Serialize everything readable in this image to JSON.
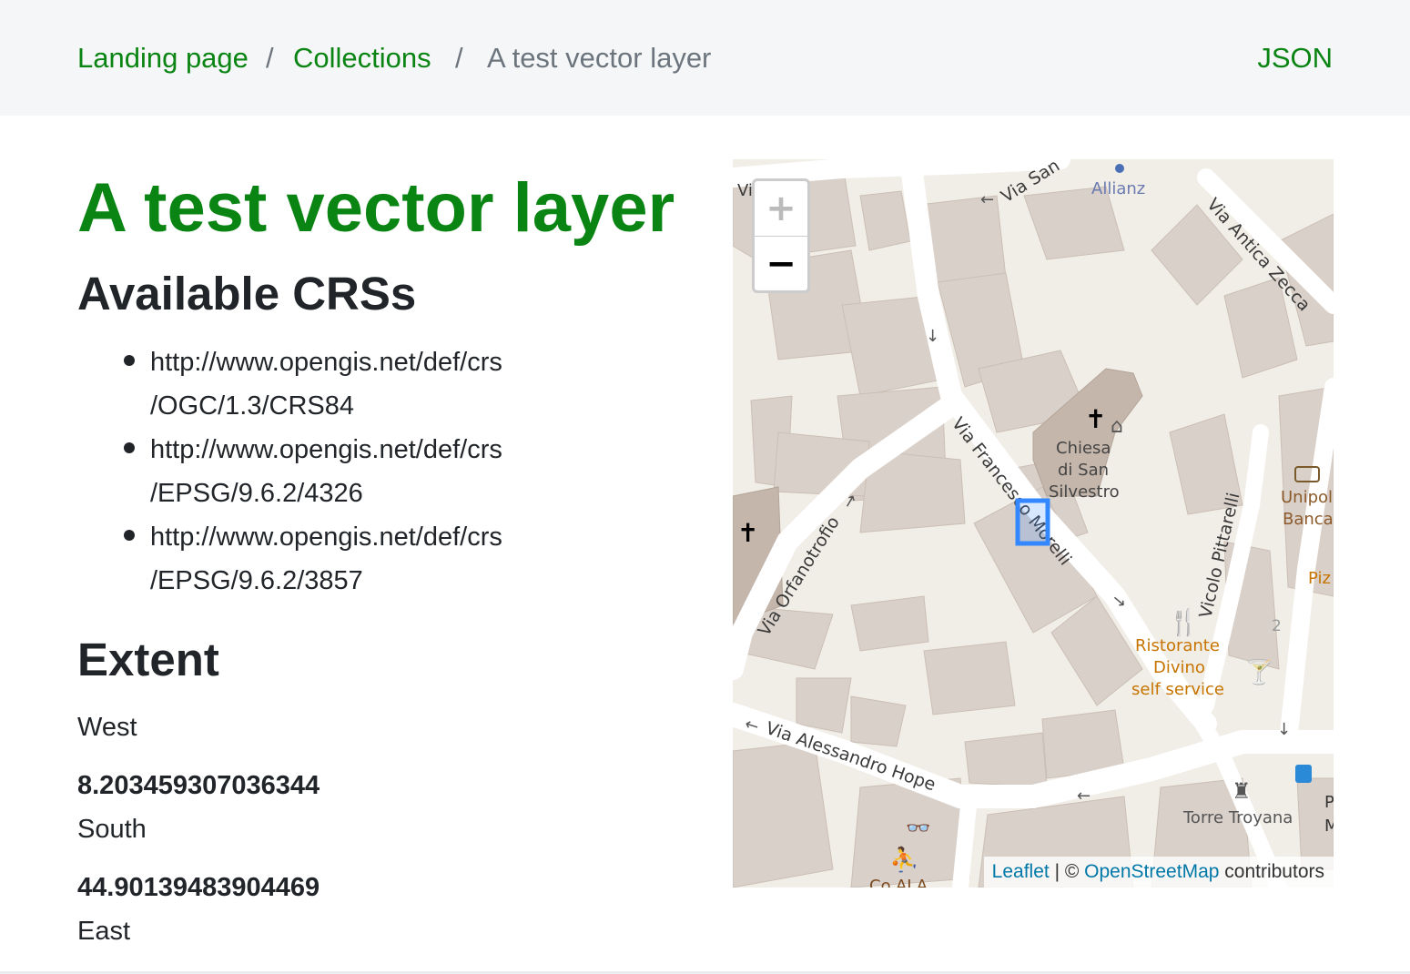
{
  "breadcrumb": {
    "items": [
      "Landing page",
      "Collections"
    ],
    "separator": "/",
    "current": "A test vector layer",
    "json_link": "JSON"
  },
  "page": {
    "title": "A test vector layer"
  },
  "crs": {
    "heading": "Available CRSs",
    "items": [
      {
        "line1": "http://www.opengis.net/def/crs",
        "line2": "/OGC/1.3/CRS84"
      },
      {
        "line1": "http://www.opengis.net/def/crs",
        "line2": "/EPSG/9.6.2/4326"
      },
      {
        "line1": "http://www.opengis.net/def/crs",
        "line2": "/EPSG/9.6.2/3857"
      }
    ]
  },
  "extent": {
    "heading": "Extent",
    "west_label": "West",
    "west_value": "8.203459307036344",
    "south_label": "South",
    "south_value": "44.90139483904469",
    "east_label": "East"
  },
  "map": {
    "zoom_in": "+",
    "zoom_out": "−",
    "attribution_leaflet": "Leaflet",
    "attribution_sep": "| ©",
    "attribution_osm": "OpenStreetMap",
    "attribution_suffix": "contributors",
    "labels": {
      "via_san": "Via San",
      "allianz": "Allianz",
      "via_antica_zecca": "Via Antica Zecca",
      "chiesa1": "Chiesa",
      "chiesa2": "di San",
      "chiesa3": "Silvestro",
      "via_francesco_morelli": "Via Francesco Morelli",
      "via_orfanotrofio": "Via Orfanotrofio",
      "vicolo_pittarelli": "Vicolo Pittarelli",
      "unipol1": "Unipol",
      "unipol2": "Banca",
      "piz": "Piz",
      "ristorante1": "Ristorante",
      "ristorante2": "Divino",
      "ristorante3": "self service",
      "via_alessandro_hope": "Via Alessandro Hope",
      "torre_troyana": "Torre Troyana",
      "co_ala": "Co.ALA",
      "house_number": "2",
      "edge_label": "Via",
      "p_letter": "P",
      "m_letter": "M"
    },
    "colors": {
      "road": "#ffffff",
      "building": "#d9d0c9",
      "church": "#c4b6ab",
      "background": "#f1eee8",
      "poi_food": "#c77400",
      "poi_text": "#8c5a2a",
      "highlight": "#3388ff"
    }
  }
}
